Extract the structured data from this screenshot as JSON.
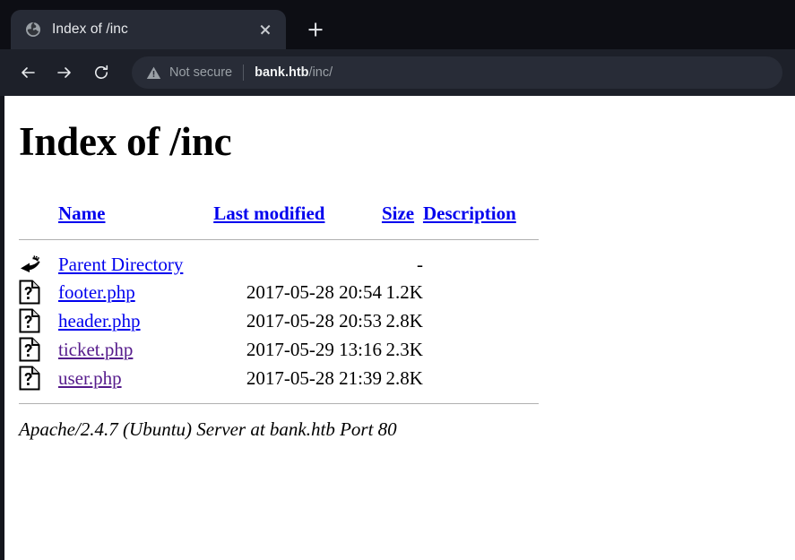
{
  "browser": {
    "tab": {
      "title": "Index of /inc",
      "favicon": "globe-icon",
      "close_label": "×"
    },
    "new_tab_label": "+",
    "nav": {
      "back": "back-icon",
      "forward": "forward-icon",
      "reload": "reload-icon"
    },
    "omnibox": {
      "security_icon": "warning-triangle-icon",
      "security_text": "Not secure",
      "url_host": "bank.htb",
      "url_path": "/inc/"
    }
  },
  "page": {
    "title": "Index of /inc",
    "columns": {
      "icon": "",
      "name": "Name",
      "last_modified": "Last modified",
      "size": "Size",
      "description": "Description"
    },
    "rows": [
      {
        "icon": "parent-directory-icon",
        "name": "Parent Directory",
        "last_modified": "",
        "size": "-",
        "description": "",
        "visited": false
      },
      {
        "icon": "unknown-file-icon",
        "name": "footer.php",
        "last_modified": "2017-05-28 20:54",
        "size": "1.2K",
        "description": "",
        "visited": false
      },
      {
        "icon": "unknown-file-icon",
        "name": "header.php",
        "last_modified": "2017-05-28 20:53",
        "size": "2.8K",
        "description": "",
        "visited": false
      },
      {
        "icon": "unknown-file-icon",
        "name": "ticket.php",
        "last_modified": "2017-05-29 13:16",
        "size": "2.3K",
        "description": "",
        "visited": true
      },
      {
        "icon": "unknown-file-icon",
        "name": "user.php",
        "last_modified": "2017-05-28 21:39",
        "size": "2.8K",
        "description": "",
        "visited": true
      }
    ],
    "server_signature": "Apache/2.4.7 (Ubuntu) Server at bank.htb Port 80"
  },
  "colors": {
    "link": "#0000ee",
    "link_visited": "#551a8b",
    "tabstrip_bg": "#0d0e14",
    "toolbar_bg": "#1d2029",
    "active_tab_bg": "#272b36",
    "omnibox_bg": "#282c37",
    "page_bg": "#ffffff"
  }
}
